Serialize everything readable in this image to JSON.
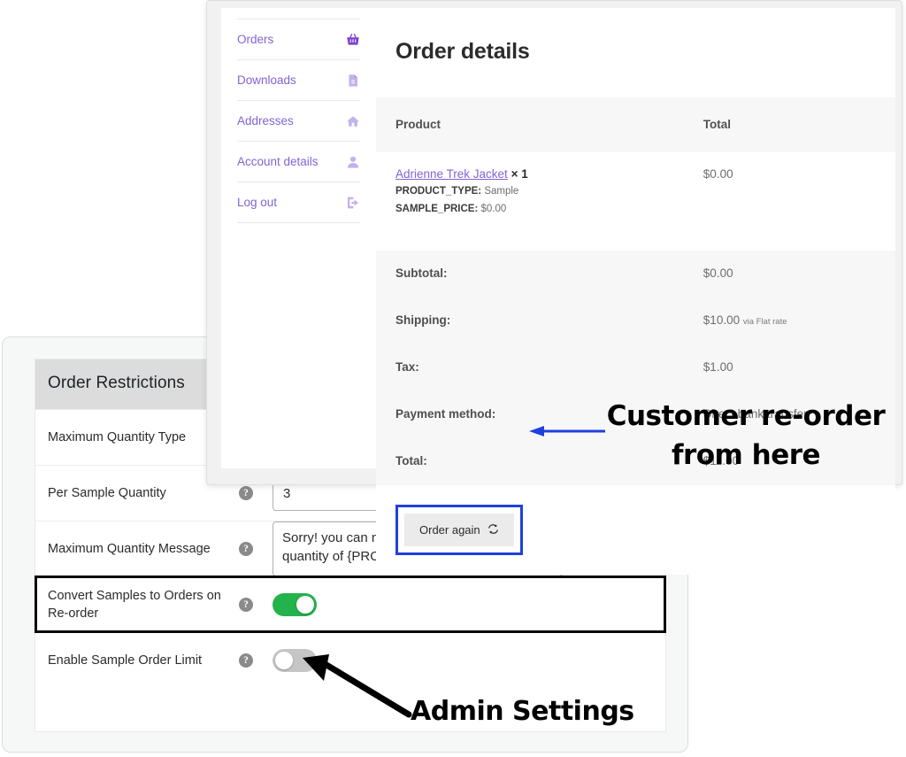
{
  "order_panel": {
    "account_nav": {
      "items": [
        {
          "label": "Orders",
          "icon": "basket-icon"
        },
        {
          "label": "Downloads",
          "icon": "document-icon"
        },
        {
          "label": "Addresses",
          "icon": "home-icon"
        },
        {
          "label": "Account details",
          "icon": "person-icon"
        },
        {
          "label": "Log out",
          "icon": "logout-icon"
        }
      ]
    },
    "title": "Order details",
    "table": {
      "headers": {
        "product": "Product",
        "total": "Total"
      },
      "line_items": [
        {
          "name": "Adrienne Trek Jacket",
          "quantity": "× 1",
          "meta": [
            {
              "key": "PRODUCT_TYPE:",
              "value": "Sample"
            },
            {
              "key": "SAMPLE_PRICE:",
              "value": "$0.00"
            }
          ],
          "total": "$0.00"
        }
      ],
      "totals": [
        {
          "label": "Subtotal:",
          "value": "$0.00",
          "note": ""
        },
        {
          "label": "Shipping:",
          "value": "$10.00",
          "note": "via Flat rate"
        },
        {
          "label": "Tax:",
          "value": "$1.00",
          "note": ""
        },
        {
          "label": "Payment method:",
          "value": "Direct bank transfer",
          "note": ""
        },
        {
          "label": "Total:",
          "value": "$11.00",
          "note": ""
        }
      ]
    },
    "order_again_label": "Order again",
    "order_again_icon": "refresh-icon"
  },
  "admin_panel": {
    "section_title": "Order Restrictions",
    "rows": [
      {
        "label": "Maximum Quantity Type",
        "control": "none",
        "value": ""
      },
      {
        "label": "Per Sample Quantity",
        "control": "input",
        "value": "3"
      },
      {
        "label": "Maximum Quantity Message",
        "control": "textarea",
        "value": "Sorry! you can not order more than {QTY} quantity of {PRODUCT} product."
      },
      {
        "label": "Convert Samples to Orders on Re-order",
        "control": "toggle",
        "value": "on"
      },
      {
        "label": "Enable Sample Order Limit",
        "control": "toggle",
        "value": "off"
      }
    ],
    "help_glyph": "?"
  },
  "annotations": {
    "customer_line1": "Customer re-order",
    "customer_line2": "from here",
    "admin": "Admin Settings",
    "arrow_blue_color": "#1f3fe0",
    "arrow_black_color": "#000000"
  },
  "colors": {
    "link_purple": "#8064d6",
    "toggle_on_green": "#23b24b",
    "toggle_off_gray": "#c6c6c6",
    "highlight_blue": "#1f3fe0",
    "header_gray": "#dcdcdc"
  }
}
